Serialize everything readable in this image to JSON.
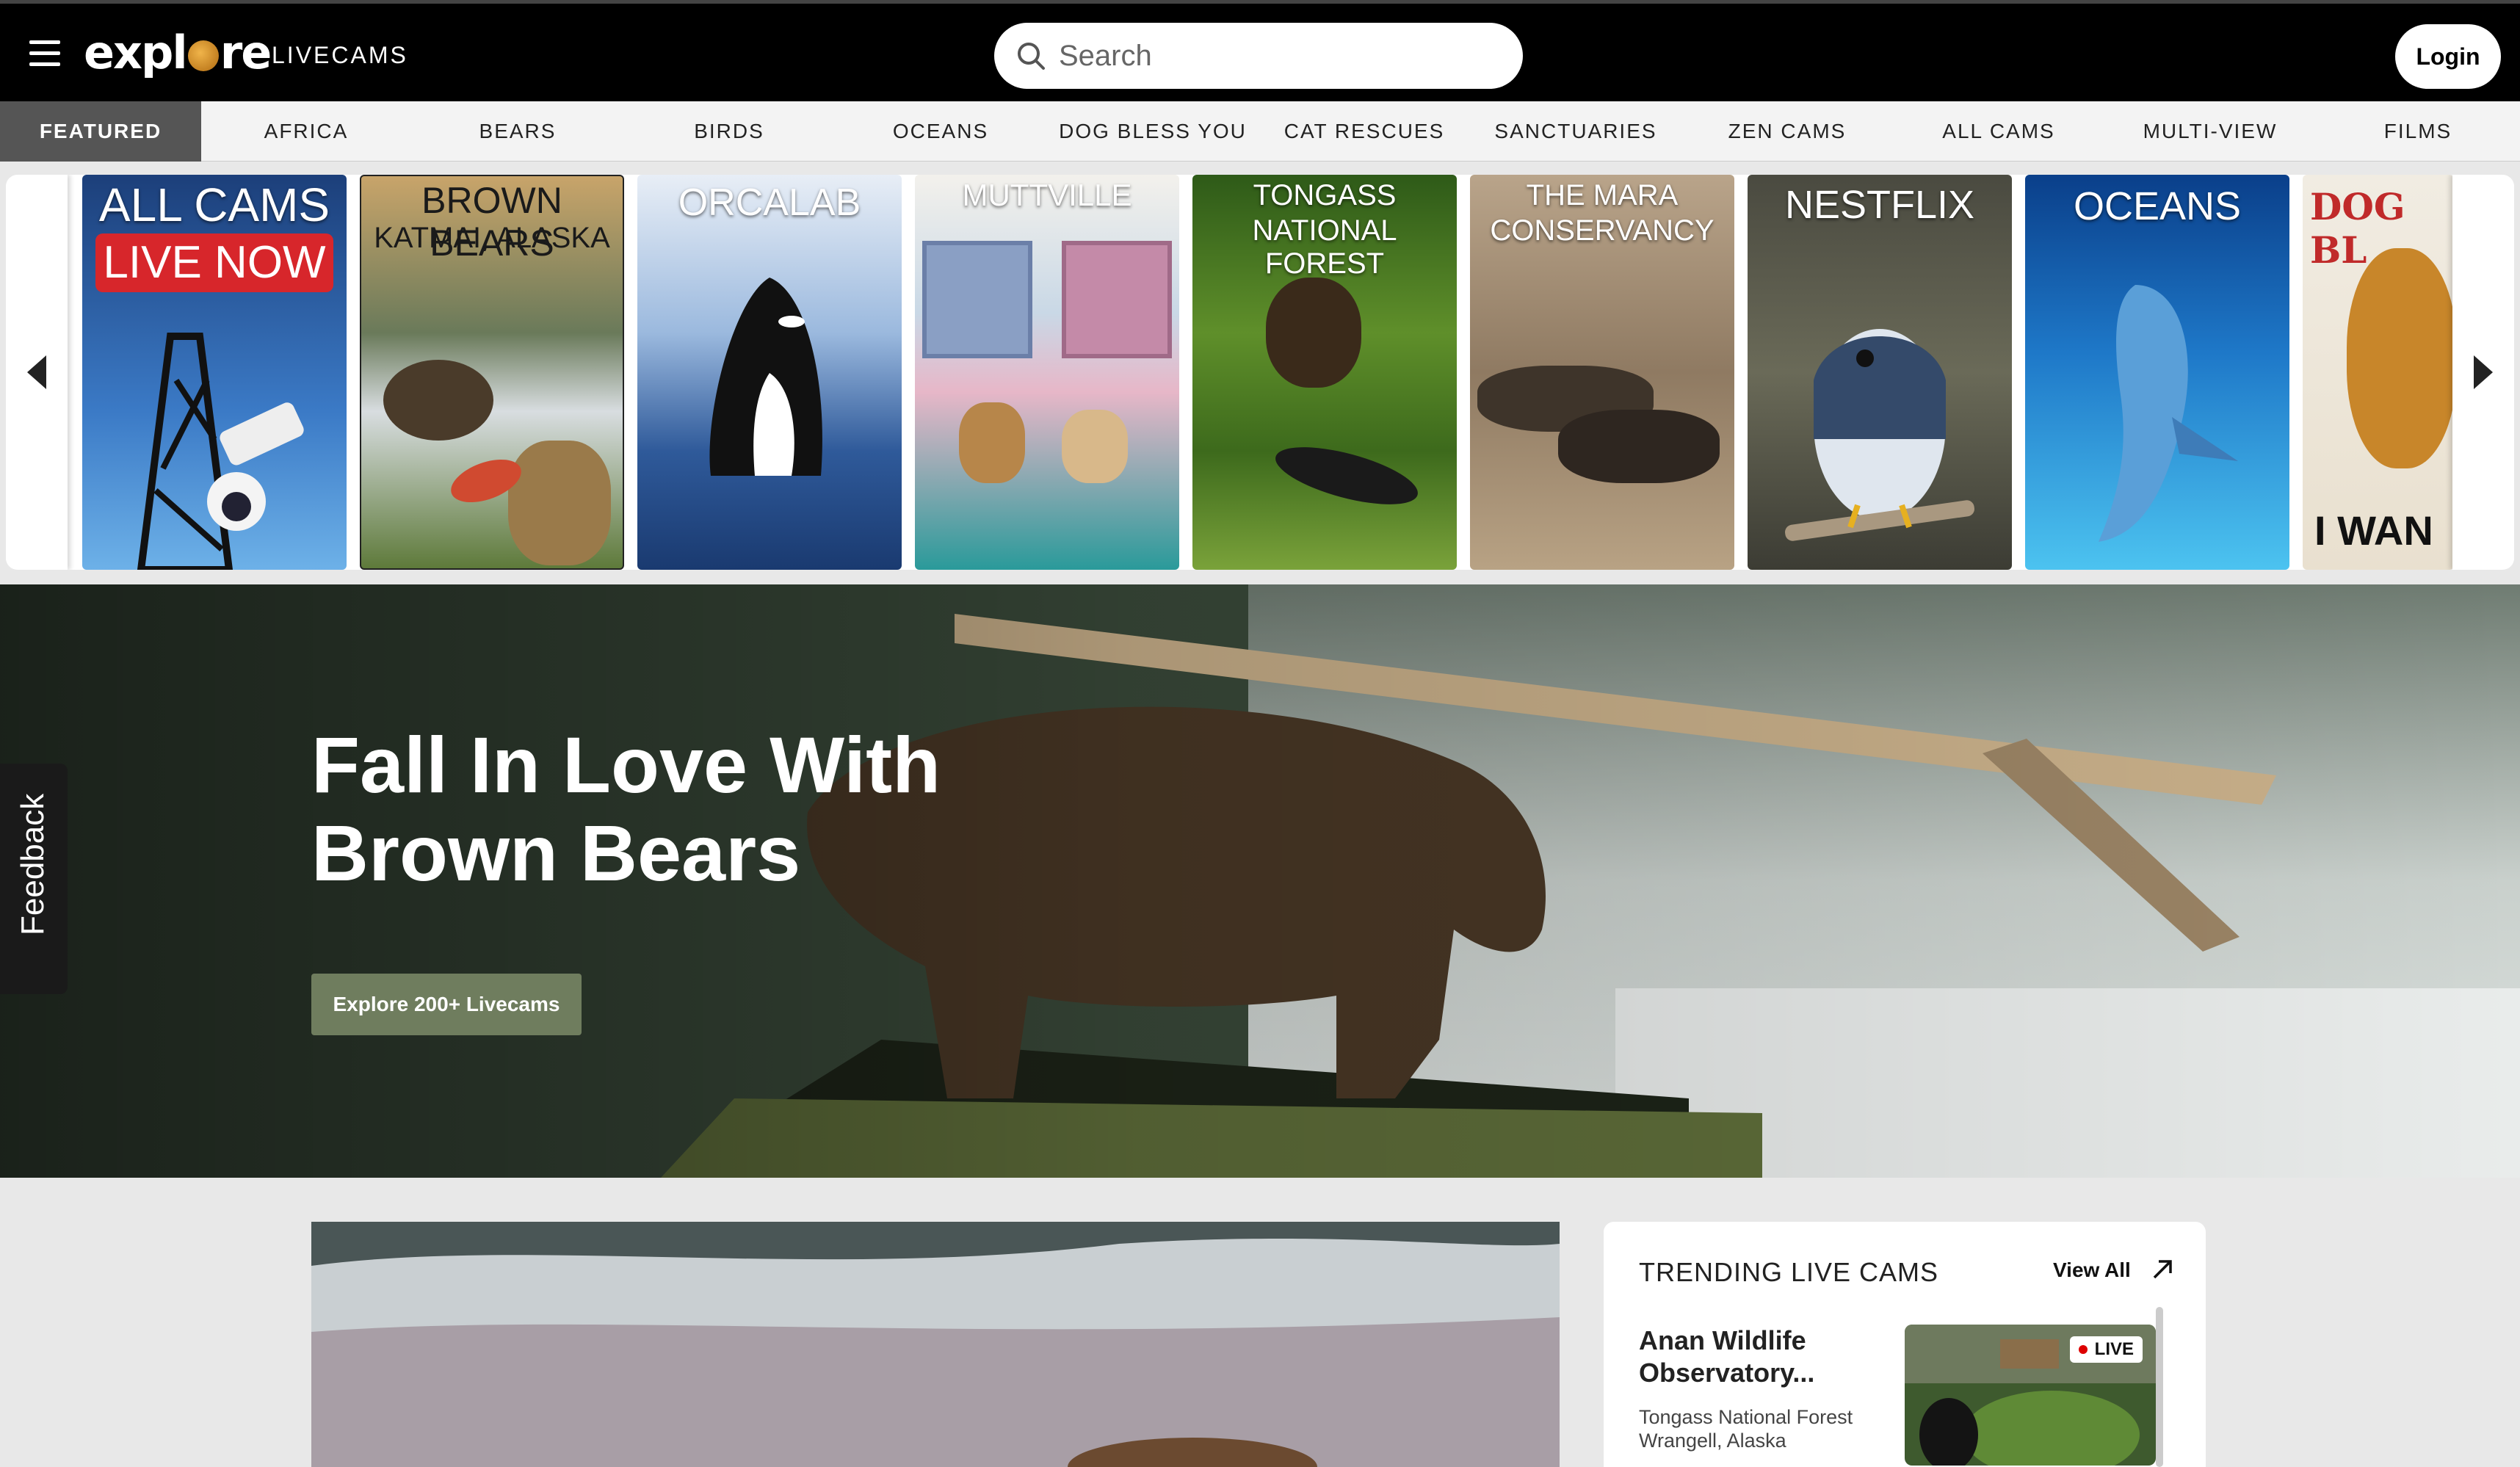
{
  "header": {
    "logo_text": "explore",
    "section_label": "LIVECAMS",
    "search_placeholder": "Search",
    "login_label": "Login"
  },
  "nav": {
    "tabs": [
      {
        "label": "FEATURED",
        "active": true
      },
      {
        "label": "AFRICA"
      },
      {
        "label": "BEARS"
      },
      {
        "label": "BIRDS"
      },
      {
        "label": "OCEANS"
      },
      {
        "label": "DOG BLESS YOU"
      },
      {
        "label": "CAT RESCUES"
      },
      {
        "label": "SANCTUARIES"
      },
      {
        "label": "ZEN CAMS"
      },
      {
        "label": "ALL CAMS"
      },
      {
        "label": "MULTI-VIEW"
      },
      {
        "label": "FILMS"
      }
    ]
  },
  "carousel": {
    "tiles": [
      {
        "title": "ALL CAMS",
        "subtitle": "LIVE NOW"
      },
      {
        "title": "BROWN BEARS",
        "subtitle": "KATMAI, ALASKA"
      },
      {
        "title": "ORCALAB"
      },
      {
        "title": "MUTTVILLE"
      },
      {
        "title": "TONGASS",
        "subtitle": "NATIONAL FOREST"
      },
      {
        "title": "THE MARA",
        "subtitle": "CONSERVANCY"
      },
      {
        "title": "NESTFLIX"
      },
      {
        "title": "OCEANS"
      },
      {
        "title": "DOG BL",
        "subtitle": "I WAN"
      }
    ]
  },
  "hero": {
    "headline": "Fall In Love With Brown Bears",
    "cta_label": "Explore 200+ Livecams"
  },
  "feedback_label": "Feedback",
  "trending": {
    "heading": "TRENDING LIVE CAMS",
    "view_all_label": "View All",
    "items": [
      {
        "name": "Anan Wildlife Observatory...",
        "location_line1": "Tongass National Forest",
        "location_line2": "Wrangell, Alaska",
        "badge": "LIVE"
      }
    ]
  },
  "colors": {
    "topbar": "#000000",
    "nav_active": "#555555",
    "cta": "#6f7d5e",
    "live_dot": "#dd0000"
  }
}
